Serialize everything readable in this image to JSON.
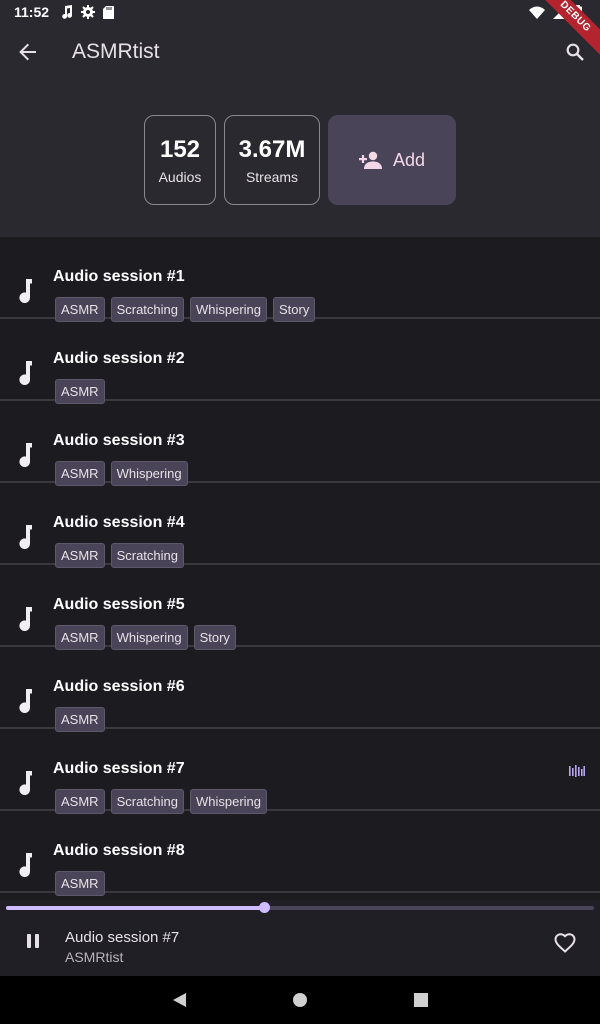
{
  "status_bar": {
    "time": "11:52",
    "icons_left": [
      "music-note-icon",
      "gear-icon",
      "sd-card-icon"
    ],
    "icons_right": [
      "wifi-icon",
      "cellular-icon",
      "battery-icon"
    ]
  },
  "debug_ribbon": "DEBUG",
  "app_bar": {
    "title": "ASMRtist",
    "back_icon": "arrow-back-icon",
    "search_icon": "search-icon"
  },
  "stats": {
    "audios_value": "152",
    "audios_label": "Audios",
    "streams_value": "3.67M",
    "streams_label": "Streams",
    "add_label": "Add",
    "add_icon": "person-add-icon"
  },
  "sessions": [
    {
      "title": "Audio session #1",
      "tags": [
        "ASMR",
        "Scratching",
        "Whispering",
        "Story"
      ],
      "playing": false
    },
    {
      "title": "Audio session #2",
      "tags": [
        "ASMR"
      ],
      "playing": false
    },
    {
      "title": "Audio session #3",
      "tags": [
        "ASMR",
        "Whispering"
      ],
      "playing": false
    },
    {
      "title": "Audio session #4",
      "tags": [
        "ASMR",
        "Scratching"
      ],
      "playing": false
    },
    {
      "title": "Audio session #5",
      "tags": [
        "ASMR",
        "Whispering",
        "Story"
      ],
      "playing": false
    },
    {
      "title": "Audio session #6",
      "tags": [
        "ASMR"
      ],
      "playing": false
    },
    {
      "title": "Audio session #7",
      "tags": [
        "ASMR",
        "Scratching",
        "Whispering"
      ],
      "playing": true
    },
    {
      "title": "Audio session #8",
      "tags": [
        "ASMR"
      ],
      "playing": false
    }
  ],
  "player": {
    "title": "Audio session #7",
    "artist": "ASMRtist",
    "progress": 0.44,
    "state": "playing",
    "pause_icon": "pause-icon",
    "favorite_icon": "heart-outline-icon"
  },
  "nav_bar": {
    "icons": [
      "back-triangle-icon",
      "home-circle-icon",
      "recents-square-icon"
    ]
  },
  "colors": {
    "background": "#1c1b20",
    "surface": "#2b2930",
    "chip": "#4a4458",
    "accent": "#d0bcff",
    "add_text": "#f2d8e6"
  }
}
